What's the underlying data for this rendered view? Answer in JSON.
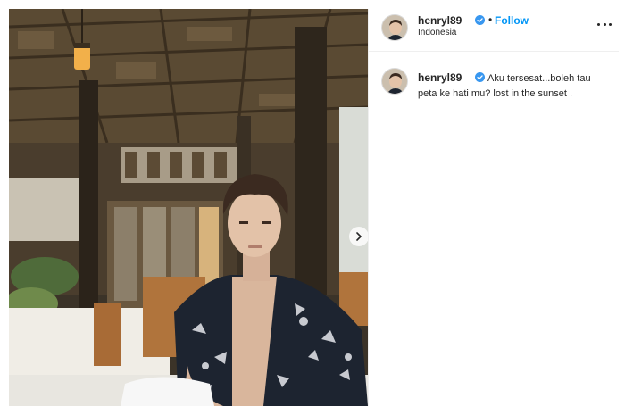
{
  "post": {
    "username": "henryl89",
    "verified": true,
    "separator": "•",
    "follow_label": "Follow",
    "location": "Indonesia",
    "more_icon": "more-horizontal-icon"
  },
  "caption": {
    "username": "henryl89",
    "text": "Aku tersesat...boleh tau peta ke hati mu? lost in the sunset ."
  },
  "colors": {
    "follow_blue": "#0095f6",
    "verified_blue": "#3897f0",
    "text": "#262626",
    "divider": "#efefef"
  },
  "carousel": {
    "next_icon": "chevron-right-icon"
  }
}
